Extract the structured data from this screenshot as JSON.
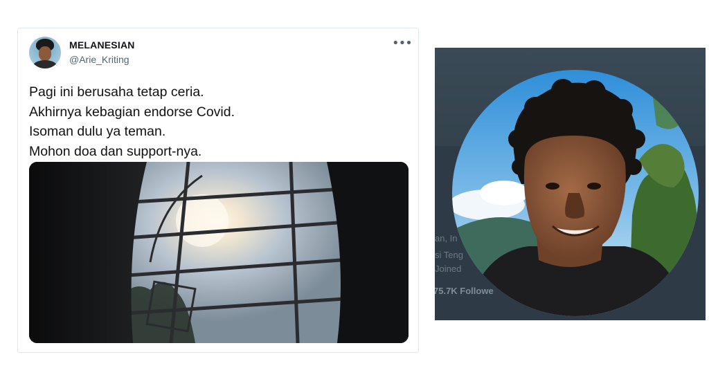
{
  "tweet": {
    "display_name": "MELANESIAN",
    "handle": "@Arie_Kriting",
    "more_icon": "more-horizontal-icon",
    "lines": [
      "Pagi ini berusaha tetap ceria.",
      "Akhirnya kebagian endorse Covid.",
      "Isoman dulu ya teman.",
      "Mohon doa dan support-nya."
    ]
  },
  "profile_panel": {
    "partial_texts": [
      "an, In",
      "si Teng",
      "Joined",
      "75.7K Followe"
    ]
  },
  "colors": {
    "background": "#ffffff",
    "card_border": "#e1e8ed",
    "handle_gray": "#536471",
    "profile_bg": "#2e3b46"
  }
}
